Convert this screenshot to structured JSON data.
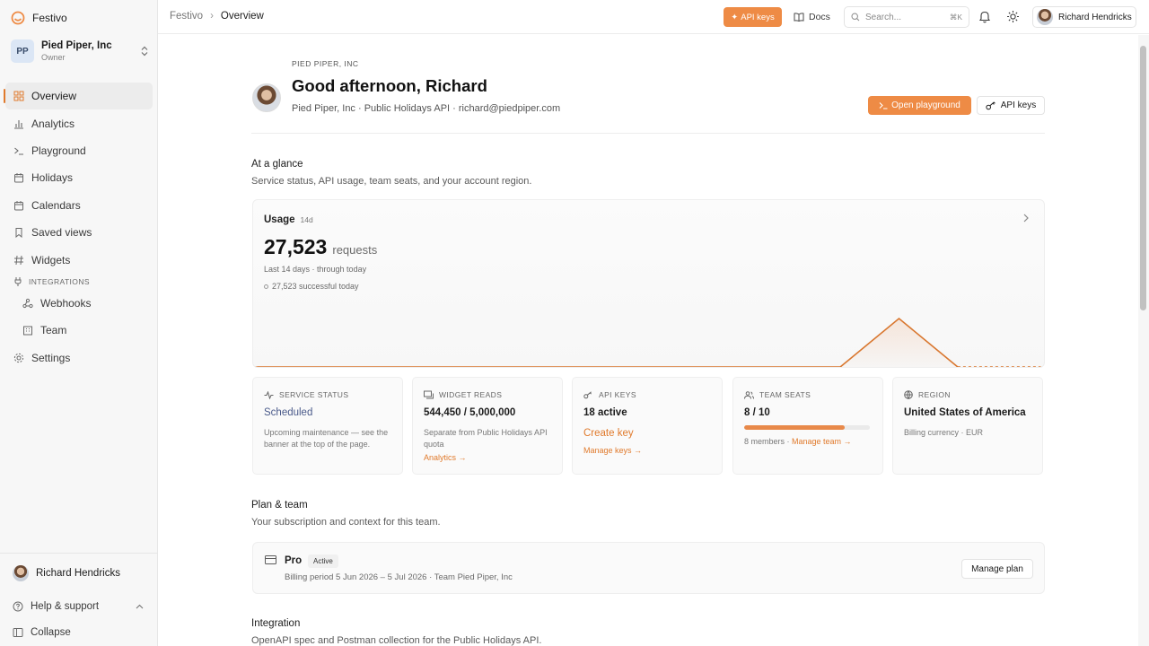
{
  "brand": {
    "name": "Festivo"
  },
  "org": {
    "initials": "PP",
    "name": "Pied Piper, Inc",
    "role": "Owner"
  },
  "sidebar": {
    "items": [
      {
        "label": "Overview",
        "icon": "grid-icon",
        "active": true
      },
      {
        "label": "Analytics",
        "icon": "bar-chart-icon"
      },
      {
        "label": "Playground",
        "icon": "terminal-icon"
      },
      {
        "label": "Holidays",
        "icon": "calendar-icon"
      },
      {
        "label": "Calendars",
        "icon": "calendar-icon"
      },
      {
        "label": "Saved views",
        "icon": "bookmark-icon"
      },
      {
        "label": "Widgets",
        "icon": "hash-icon"
      }
    ],
    "section_label": "INTEGRATIONS",
    "sub_items": [
      {
        "label": "Webhooks",
        "icon": "webhook-icon"
      },
      {
        "label": "Team",
        "icon": "building-icon"
      }
    ],
    "settings_label": "Settings",
    "user_name": "Richard Hendricks",
    "help_label": "Help & support",
    "collapse_label": "Collapse"
  },
  "topbar": {
    "crumb_root": "Festivo",
    "crumb_current": "Overview",
    "api_keys_label": "API keys",
    "docs_label": "Docs",
    "search_placeholder": "Search...",
    "search_shortcut": "⌘K",
    "user_name": "Richard Hendricks"
  },
  "hero": {
    "eyebrow": "PIED PIPER, INC",
    "title": "Good afternoon, Richard",
    "subtitle": "Pied Piper, Inc · Public Holidays API · richard@piedpiper.com",
    "playground_label": "Open playground",
    "apikeys_label": "API keys"
  },
  "glance": {
    "title": "At a glance",
    "subtitle": "Service status, API usage, team seats, and your account region."
  },
  "usage": {
    "label": "Usage",
    "range": "14d",
    "value": "27,523",
    "unit": "requests",
    "period": "Last 14 days · through today",
    "success": "27,523 successful today"
  },
  "chart_data": {
    "type": "area",
    "x": [
      1,
      2,
      3,
      4,
      5,
      6,
      7,
      8,
      9,
      10,
      11,
      12,
      13,
      14
    ],
    "values": [
      0,
      0,
      0,
      0,
      0,
      0,
      0,
      0,
      0,
      0,
      0,
      1,
      0,
      0
    ],
    "projected_segment": "last day dashed",
    "color": "#d9772f"
  },
  "stats": [
    {
      "label": "SERVICE STATUS",
      "icon": "activity-icon",
      "value": "Scheduled",
      "desc": "Upcoming maintenance — see the banner at the top of the page."
    },
    {
      "label": "WIDGET READS",
      "icon": "widget-icon",
      "value": "544,450 / 5,000,000",
      "desc": "Separate from Public Holidays API quota",
      "link": "Analytics →"
    },
    {
      "label": "API KEYS",
      "icon": "key-icon",
      "value": "18 active",
      "action": "Create key",
      "link": "Manage keys →"
    },
    {
      "label": "TEAM SEATS",
      "icon": "users-icon",
      "value": "8 / 10",
      "fill": 0.8,
      "members": "8 members",
      "link": "Manage team →"
    },
    {
      "label": "REGION",
      "icon": "globe-icon",
      "value": "United States of America",
      "desc": "Billing currency · EUR"
    }
  ],
  "plan": {
    "section_title": "Plan & team",
    "section_sub": "Your subscription and context for this team.",
    "name": "Pro",
    "badge": "Active",
    "billing": "Billing period 5 Jun 2026 – 5 Jul 2026 · Team Pied Piper, Inc",
    "manage_label": "Manage plan"
  },
  "integration": {
    "title": "Integration",
    "subtitle": "OpenAPI spec and Postman collection for the Public Holidays API."
  },
  "colors": {
    "accent": "#ee8b45",
    "accent_text": "#e07a2c"
  }
}
